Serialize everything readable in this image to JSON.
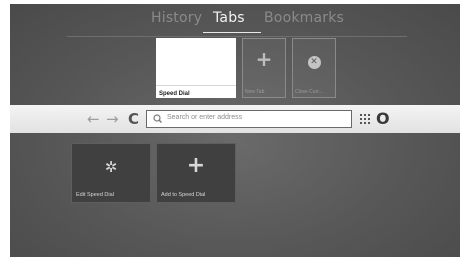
{
  "top_tabs": [
    {
      "label": "History"
    },
    {
      "label": "Tabs",
      "active": true
    },
    {
      "label": "Bookmarks"
    }
  ],
  "tab_thumbnails": {
    "speed_dial": {
      "label": "Speed Dial"
    },
    "new_tab": {
      "label": "New Tab",
      "icon": "plus-icon"
    },
    "close_current": {
      "label": "Close Curr...",
      "icon": "close-circle-icon"
    }
  },
  "address_bar": {
    "back_icon": "←",
    "forward_icon": "→",
    "reload_icon": "C",
    "placeholder": "Search or enter address",
    "opera_logo": "O"
  },
  "speed_dial_tiles": [
    {
      "label": "Edit Speed Dial",
      "icon": "gear-icon"
    },
    {
      "label": "Add to Speed Dial",
      "icon": "plus-icon"
    }
  ],
  "colors": {
    "background": "#575757",
    "active_tab_text": "#f2f2f2",
    "inactive_tab_text": "#8a8a8a",
    "address_band": "#e8e8e8",
    "tile_background": "#404040"
  }
}
